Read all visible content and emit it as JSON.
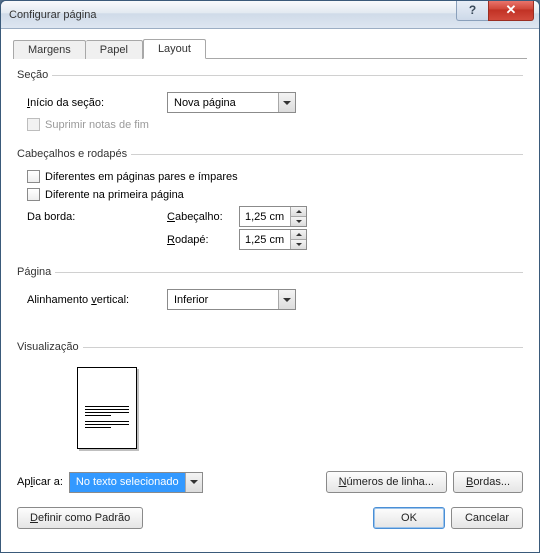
{
  "window": {
    "title": "Configurar página"
  },
  "tabs": {
    "margins": "Margens",
    "paper": "Papel",
    "layout": "Layout"
  },
  "section": {
    "legend": "Seção",
    "start_label": "Início da seção:",
    "start_value": "Nova página",
    "suppress_endnotes": "Suprimir notas de fim"
  },
  "headers": {
    "legend": "Cabeçalhos e rodapés",
    "diff_odd_even": "Diferentes em páginas pares e ímpares",
    "diff_first": "Diferente na primeira página",
    "from_edge": "Da borda:",
    "header_label": "Cabeçalho:",
    "header_value": "1,25 cm",
    "footer_label": "Rodapé:",
    "footer_value": "1,25 cm"
  },
  "page": {
    "legend": "Página",
    "valign_label": "Alinhamento vertical:",
    "valign_value": "Inferior"
  },
  "preview": {
    "legend": "Visualização"
  },
  "apply": {
    "label": "Aplicar a:",
    "value": "No texto selecionado"
  },
  "buttons": {
    "line_numbers": "Números de linha...",
    "borders": "Bordas...",
    "set_default": "Definir como Padrão",
    "ok": "OK",
    "cancel": "Cancelar"
  }
}
